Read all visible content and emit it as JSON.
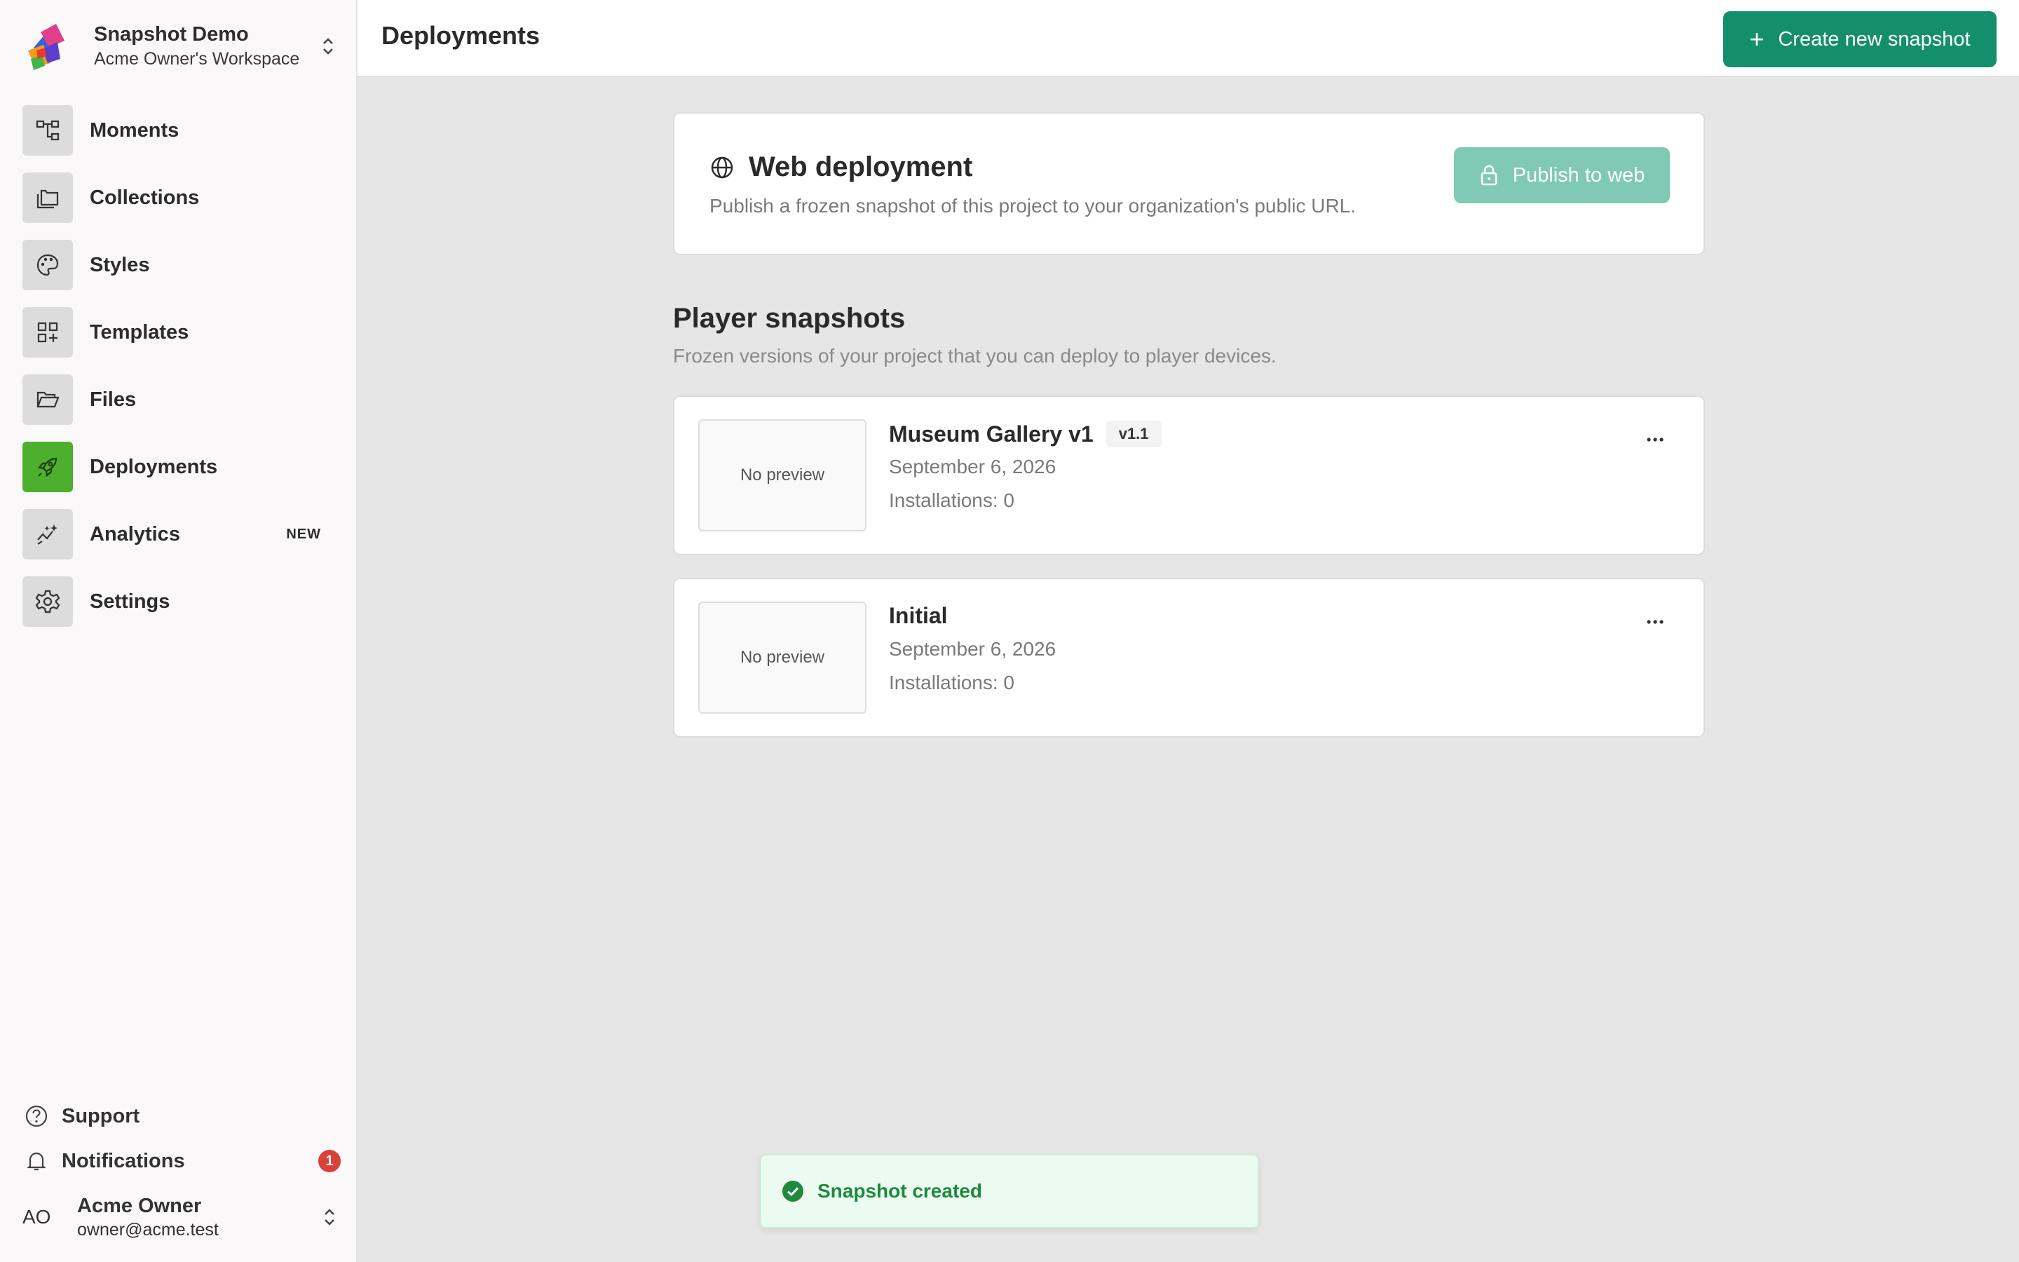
{
  "workspace": {
    "name": "Snapshot Demo",
    "subtitle": "Acme Owner's Workspace"
  },
  "sidebar": {
    "items": [
      {
        "label": "Moments",
        "icon": "hierarchy-icon"
      },
      {
        "label": "Collections",
        "icon": "collections-icon"
      },
      {
        "label": "Styles",
        "icon": "palette-icon"
      },
      {
        "label": "Templates",
        "icon": "templates-icon"
      },
      {
        "label": "Files",
        "icon": "folder-open-icon"
      },
      {
        "label": "Deployments",
        "icon": "rocket-icon",
        "active": true
      },
      {
        "label": "Analytics",
        "icon": "sparkline-icon",
        "badge": "NEW"
      },
      {
        "label": "Settings",
        "icon": "gear-icon"
      }
    ],
    "support_label": "Support",
    "notifications_label": "Notifications",
    "notifications_count": "1",
    "user": {
      "initials": "AO",
      "name": "Acme Owner",
      "email": "owner@acme.test"
    }
  },
  "header": {
    "title": "Deployments",
    "create_label": "Create new snapshot"
  },
  "web_deployment": {
    "title": "Web deployment",
    "description": "Publish a frozen snapshot of this project to your organization's public URL.",
    "publish_label": "Publish to web"
  },
  "player_snapshots": {
    "title": "Player snapshots",
    "subtitle": "Frozen versions of your project that you can deploy to player devices.",
    "items": [
      {
        "name": "Museum Gallery v1",
        "version": "v1.1",
        "date": "September 6, 2026",
        "installations": "Installations: 0",
        "preview": "No preview"
      },
      {
        "name": "Initial",
        "date": "September 6, 2026",
        "installations": "Installations: 0",
        "preview": "No preview"
      }
    ]
  },
  "toast": {
    "message": "Snapshot created"
  },
  "colors": {
    "accent": "#148f6b",
    "accent_disabled": "#80c9b5",
    "active_nav": "#4caf2e",
    "notification": "#d9413a",
    "success": "#1f8a3b"
  }
}
